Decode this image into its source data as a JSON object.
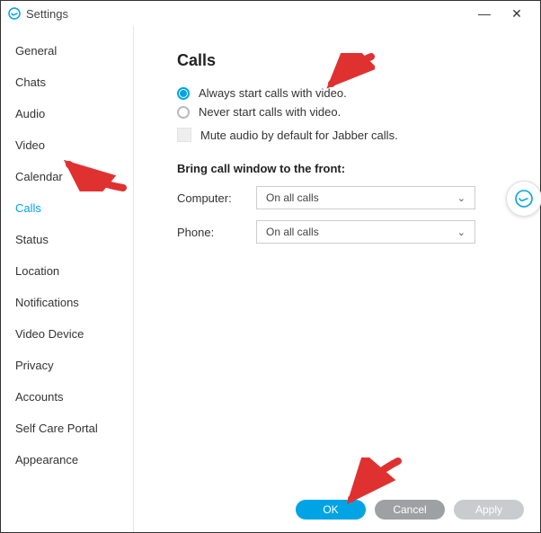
{
  "colors": {
    "accent": "#00a4e4",
    "arrow": "#e03131"
  },
  "titlebar": {
    "title": "Settings",
    "minimize": "—",
    "close": "✕"
  },
  "sidebar": {
    "items": [
      {
        "label": "General"
      },
      {
        "label": "Chats"
      },
      {
        "label": "Audio"
      },
      {
        "label": "Video"
      },
      {
        "label": "Calendar"
      },
      {
        "label": "Calls",
        "active": true
      },
      {
        "label": "Status"
      },
      {
        "label": "Location"
      },
      {
        "label": "Notifications"
      },
      {
        "label": "Video Device"
      },
      {
        "label": "Privacy"
      },
      {
        "label": "Accounts"
      },
      {
        "label": "Self Care Portal"
      },
      {
        "label": "Appearance"
      }
    ]
  },
  "panel": {
    "heading": "Calls",
    "radio_always": "Always start calls with video.",
    "radio_never": "Never start calls with video.",
    "check_mute": "Mute audio by default for Jabber calls.",
    "bring_front": "Bring call window to the front:",
    "computer_label": "Computer:",
    "phone_label": "Phone:",
    "computer_value": "On all calls",
    "phone_value": "On all calls"
  },
  "footer": {
    "ok": "OK",
    "cancel": "Cancel",
    "apply": "Apply"
  }
}
